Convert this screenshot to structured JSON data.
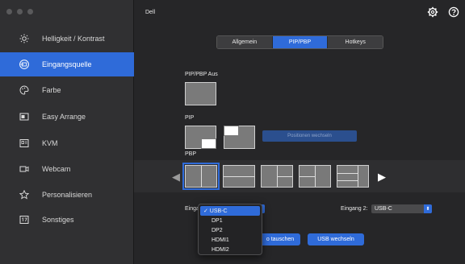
{
  "app": {
    "title": "Dell"
  },
  "sidebar": {
    "items": [
      {
        "label": "Helligkeit / Kontrast",
        "icon": "sun-icon"
      },
      {
        "label": "Eingangsquelle",
        "icon": "input-source-icon"
      },
      {
        "label": "Farbe",
        "icon": "palette-icon"
      },
      {
        "label": "Easy Arrange",
        "icon": "easy-arrange-icon"
      },
      {
        "label": "KVM",
        "icon": "kvm-icon"
      },
      {
        "label": "Webcam",
        "icon": "webcam-icon"
      },
      {
        "label": "Personalisieren",
        "icon": "star-icon"
      },
      {
        "label": "Sonstiges",
        "icon": "misc-icon"
      }
    ],
    "active_index": 1
  },
  "tabs": [
    {
      "label": "Allgemein"
    },
    {
      "label": "PIP/PBP"
    },
    {
      "label": "Hotkeys"
    }
  ],
  "active_tab": 1,
  "sections": {
    "off_label": "PIP/PBP Aus",
    "pip_label": "PIP",
    "pbp_label": "PBP",
    "positions_button": "Positionen wechseln"
  },
  "inputs": {
    "input1_label": "Eingang 1:",
    "input1_value": "USB-C",
    "input2_label": "Eingang 2:",
    "input2_value": "USB-C"
  },
  "dropdown": {
    "options": [
      "✓ USB-C",
      "DP1",
      "DP2",
      "HDMI1",
      "HDMI2"
    ],
    "selected_index": 0
  },
  "buttons": {
    "swap_label": "o tauschen",
    "usb_label": "USB wechseln"
  },
  "colors": {
    "accent": "#2f6bd9",
    "sidebar": "#303032",
    "background": "#262628"
  }
}
